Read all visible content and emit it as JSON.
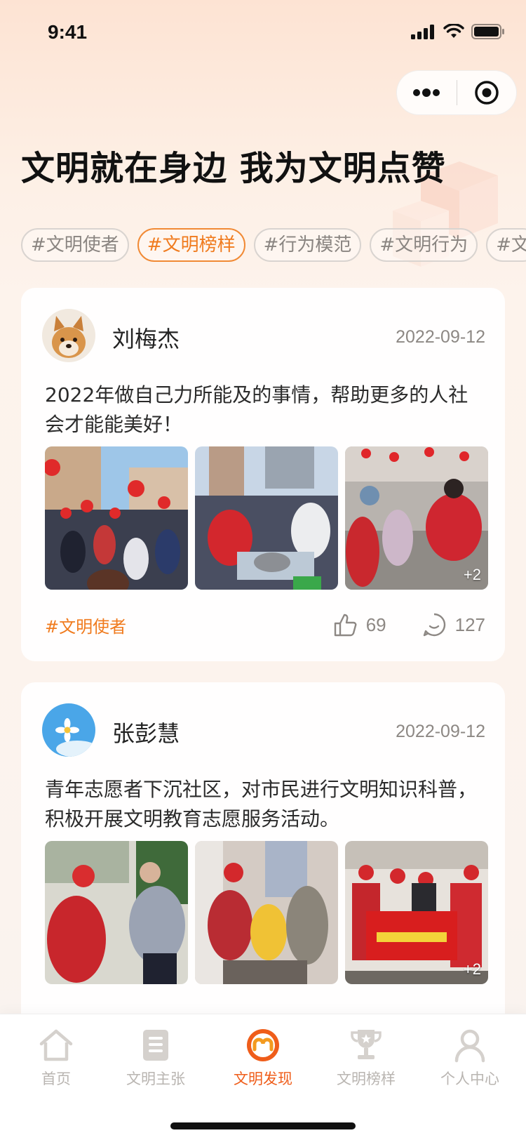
{
  "status_bar": {
    "time": "9:41"
  },
  "capsule": {
    "more_icon": "more-dots-icon",
    "close_icon": "target-circle-icon"
  },
  "headline": "文明就在身边 我为文明点赞",
  "tags": [
    {
      "label": "#文明使者",
      "active": false
    },
    {
      "label": "#文明榜样",
      "active": true
    },
    {
      "label": "#行为模范",
      "active": false
    },
    {
      "label": "#文明行为",
      "active": false
    },
    {
      "label": "#文",
      "active": false
    }
  ],
  "posts": [
    {
      "user": "刘梅杰",
      "date": "2022-09-12",
      "text": "2022年做自己力所能及的事情，帮助更多的人社会才能能美好！",
      "extra_photos": "+2",
      "tag": "#文明使者",
      "likes": "69",
      "comments": "127"
    },
    {
      "user": "张彭慧",
      "date": "2022-09-12",
      "text": "青年志愿者下沉社区，对市民进行文明知识科普，积极开展文明教育志愿服务活动。",
      "extra_photos": "+2"
    }
  ],
  "tab_bar": {
    "items": [
      {
        "label": "首页",
        "icon": "home-icon"
      },
      {
        "label": "文明主张",
        "icon": "document-icon"
      },
      {
        "label": "文明发现",
        "icon": "discover-icon"
      },
      {
        "label": "文明榜样",
        "icon": "trophy-icon"
      },
      {
        "label": "个人中心",
        "icon": "user-icon"
      }
    ],
    "active_index": 2
  },
  "colors": {
    "accent": "#f07b1e",
    "tab_active": "#ef5d1a",
    "muted": "#8d8884"
  }
}
